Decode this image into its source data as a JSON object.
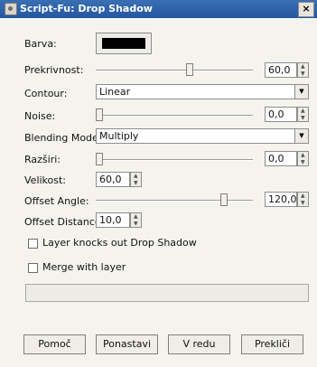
{
  "window": {
    "title": "Script-Fu: Drop Shadow",
    "close_label": "×"
  },
  "colors": {
    "titlebar": "#2f62a8",
    "shadow_color": "#000000"
  },
  "fields": {
    "barva_label": "Barva:",
    "prekrivnost_label": "Prekrivnost:",
    "prekrivnost_value": "60,0",
    "prekrivnost_fraction": 0.6,
    "contour_label": "Contour:",
    "contour_value": "Linear",
    "noise_label": "Noise:",
    "noise_value": "0,0",
    "noise_fraction": 0.0,
    "blending_label": "Blending Mode:",
    "blending_value": "Multiply",
    "razsiri_label": "Razširi:",
    "razsiri_value": "0,0",
    "razsiri_fraction": 0.0,
    "velikost_label": "Velikost:",
    "velikost_value": "60,0",
    "offset_angle_label": "Offset Angle:",
    "offset_angle_value": "120,0",
    "offset_angle_fraction": 0.83,
    "offset_distance_label": "Offset Distance:",
    "offset_distance_value": "10,0",
    "layer_knocks_label": "Layer knocks out Drop Shadow",
    "layer_knocks_checked": false,
    "merge_label": "Merge with layer",
    "merge_checked": false
  },
  "buttons": {
    "help": "Pomoč",
    "reset": "Ponastavi",
    "ok": "V redu",
    "cancel": "Prekliči"
  },
  "icons": {
    "title": "script-fu-icon",
    "dropdown": "chevron-down-icon"
  }
}
